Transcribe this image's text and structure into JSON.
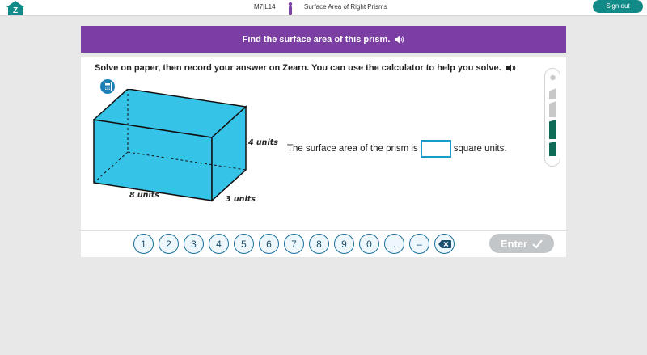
{
  "header": {
    "lesson_code": "M7|L14",
    "lesson_title": "Surface Area of Right Prisms",
    "signout_label": "Sign out",
    "home_icon": "zearn-home-icon",
    "person_icon": "student-icon"
  },
  "banner": {
    "title": "Find the surface area of this prism.",
    "audio_icon": "speaker-icon"
  },
  "card": {
    "instructions": "Solve on paper, then record your answer on Zearn. You can use the calculator to help you solve.",
    "calculator_icon": "calculator-icon",
    "figure": {
      "height_label": "4 units",
      "length_label": "8 units",
      "depth_label": "3 units"
    },
    "question": {
      "prefix": "The surface area of the prism is",
      "suffix": "square units.",
      "answer_value": ""
    },
    "progress_meter": {
      "filled_segments": 2,
      "total_segments": 4,
      "colors": {
        "filled": "#0f6b55",
        "empty": "#c8c8c8"
      }
    }
  },
  "keypad": {
    "keys": [
      "1",
      "2",
      "3",
      "4",
      "5",
      "6",
      "7",
      "8",
      "9",
      "0",
      ".",
      "–"
    ],
    "delete_icon": "backspace-icon",
    "enter_label": "Enter"
  },
  "colors": {
    "banner": "#7b3fa4",
    "accent": "#128a87",
    "prism_fill": "#35c3e8",
    "key_border": "#1a6f9c",
    "enter_disabled": "#c2c6c9"
  }
}
